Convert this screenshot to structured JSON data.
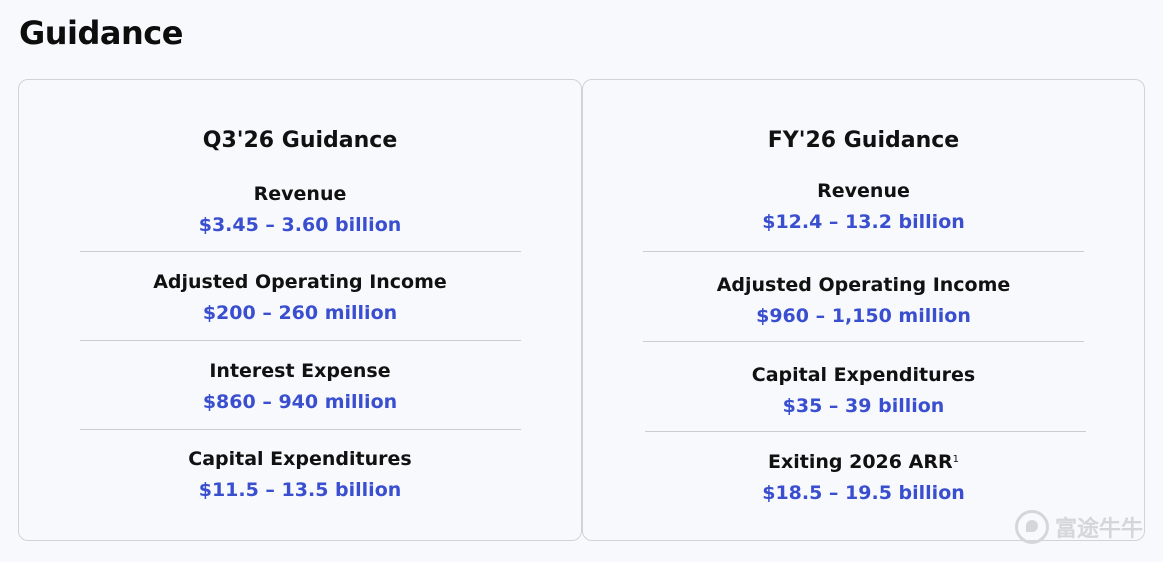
{
  "page_title": "Guidance",
  "q3": {
    "title": "Q3'26 Guidance",
    "metrics": [
      {
        "label": "Revenue",
        "value": "$3.45 – 3.60 billion"
      },
      {
        "label": "Adjusted Operating Income",
        "value": "$200 – 260 million"
      },
      {
        "label": "Interest Expense",
        "value": "$860 – 940 million"
      },
      {
        "label": "Capital Expenditures",
        "value": "$11.5 – 13.5 billion"
      }
    ]
  },
  "fy": {
    "title": "FY'26 Guidance",
    "metrics": [
      {
        "label": "Revenue",
        "value": "$12.4 – 13.2 billion"
      },
      {
        "label": "Adjusted Operating Income",
        "value": "$960 – 1,150 million"
      },
      {
        "label": "Capital Expenditures",
        "value": "$35 – 39 billion"
      },
      {
        "label": "Exiting 2026 ARR",
        "footnote": "1",
        "value": "$18.5 – 19.5 billion"
      }
    ]
  },
  "watermark": "富途牛牛",
  "colors": {
    "value_blue": "#3a4fcf",
    "border": "#cfd3da",
    "background": "#f8f9fc"
  }
}
